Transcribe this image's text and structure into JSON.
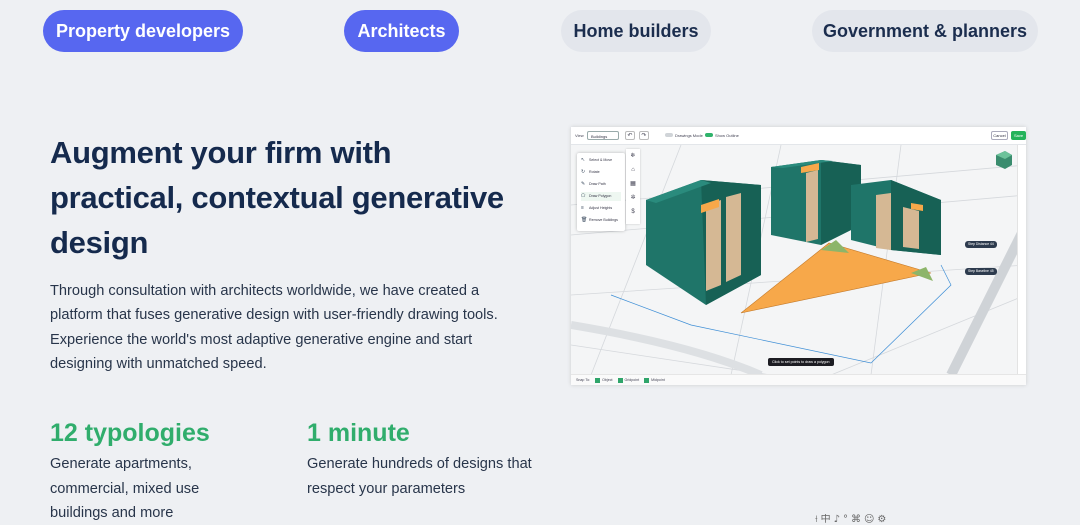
{
  "tabs": [
    {
      "label": "Property developers",
      "active": true
    },
    {
      "label": "Architects",
      "active": true
    },
    {
      "label": "Home builders",
      "active": false
    },
    {
      "label": "Government & planners",
      "active": false
    }
  ],
  "headline": "Augment your firm with practical, contextual generative design",
  "description": "Through consultation with architects worldwide, we have created a platform that fuses generative design with user-friendly drawing tools. Experience the world's most adaptive generative engine and start designing with unmatched speed.",
  "stats": [
    {
      "value": "12 typologies",
      "text": "Generate apartments, commercial, mixed use buildings and more"
    },
    {
      "value": "1 minute",
      "text": "Generate hundreds of designs that respect your parameters"
    }
  ],
  "app": {
    "toolbar": {
      "view_label": "View",
      "view_select": "Buildings",
      "undo_icon": "undo-icon",
      "redo_icon": "redo-icon",
      "toggle_1": "Drawings Mode",
      "toggle_2": "Show Outline",
      "cancel": "Cancel",
      "save": "Save"
    },
    "tool_menu": [
      "Select & Move",
      "Rotate",
      "Draw Path",
      "Draw Polygon",
      "Adjust Heights",
      "Remove Buildings"
    ],
    "rp_labels": [
      "Step Distance 44",
      "Step Baseline 45"
    ],
    "site_label": "Area",
    "tooltip": "Click to set points to draw a polygon",
    "footer": {
      "snap_label": "Snap To:",
      "options": [
        "Object",
        "Gridpoint",
        "Midpoint"
      ]
    }
  },
  "colors": {
    "accent": "#5767f0",
    "green": "#30ad6c",
    "heading": "#152a4d",
    "building": "#1f7569",
    "site": "#f7a84a"
  },
  "taskbar_icons": [
    "⟊",
    "中",
    "♪",
    "°",
    "⌘",
    "☺",
    "⚙"
  ]
}
